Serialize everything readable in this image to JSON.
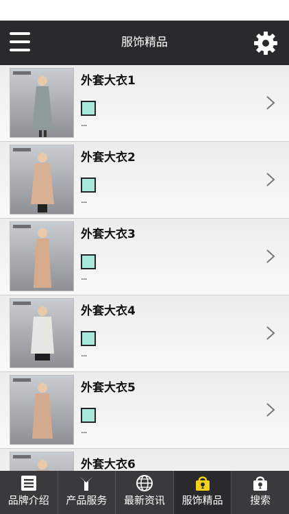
{
  "header": {
    "title": "服饰精品",
    "menu_icon": "hamburger-menu-icon",
    "settings_icon": "gear-icon"
  },
  "products": [
    {
      "title": "外套大衣1",
      "desc": "...",
      "swatch_color": "#a8e8da"
    },
    {
      "title": "外套大衣2",
      "desc": "...",
      "swatch_color": "#a8e8da"
    },
    {
      "title": "外套大衣3",
      "desc": "...",
      "swatch_color": "#a8e8da"
    },
    {
      "title": "外套大衣4",
      "desc": "...",
      "swatch_color": "#a8e8da"
    },
    {
      "title": "外套大衣5",
      "desc": "...",
      "swatch_color": "#a8e8da"
    },
    {
      "title": "外套大衣6",
      "desc": "...",
      "swatch_color": "#a8e8da"
    }
  ],
  "tabbar": {
    "tabs": [
      {
        "label": "品牌介绍",
        "icon": "id-card-icon"
      },
      {
        "label": "产品服务",
        "icon": "tools-icon"
      },
      {
        "label": "最新资讯",
        "icon": "globe-icon"
      },
      {
        "label": "服饰精品",
        "icon": "shopping-bag-icon",
        "active": true
      },
      {
        "label": "搜索",
        "icon": "location-bag-icon"
      }
    ]
  },
  "colors": {
    "header_bg": "#2a2a2c",
    "tabbar_bg": "#3a3a3c",
    "active_icon": "#f2d21b",
    "swatch": "#a8e8da"
  }
}
